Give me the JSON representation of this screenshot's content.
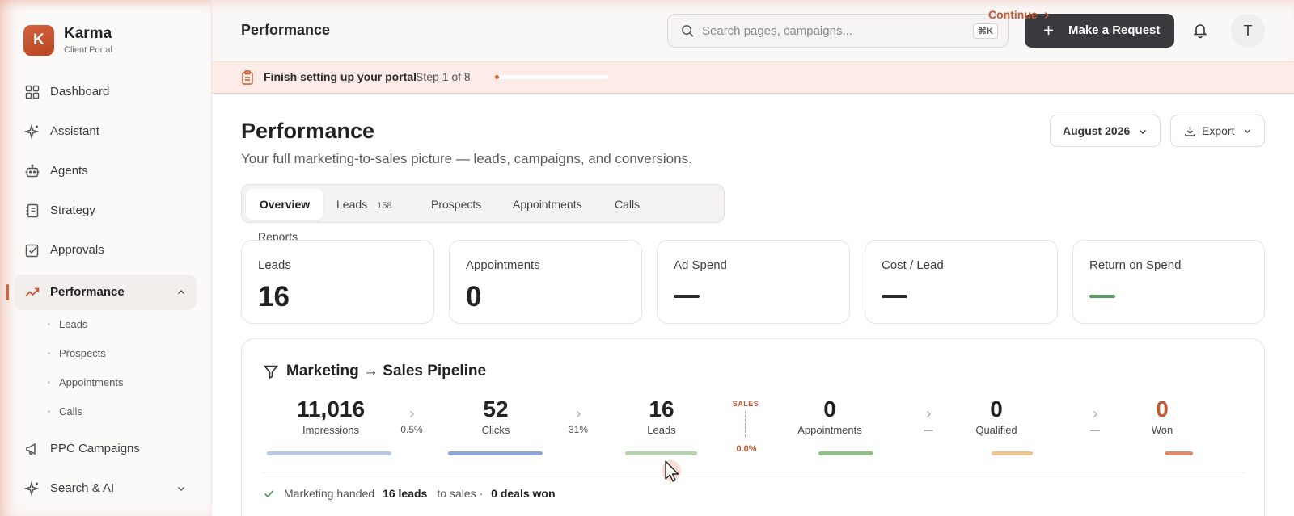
{
  "brand": {
    "logo_letter": "K",
    "name": "Karma",
    "subtitle": "Client Portal",
    "accent": "#d4623e"
  },
  "sidebar": {
    "items": [
      {
        "label": "Dashboard",
        "icon": "grid-icon"
      },
      {
        "label": "Assistant",
        "icon": "sparkle-icon"
      },
      {
        "label": "Agents",
        "icon": "robot-icon"
      },
      {
        "label": "Strategy",
        "icon": "notebook-icon"
      },
      {
        "label": "Approvals",
        "icon": "check-square-icon"
      },
      {
        "label": "Performance",
        "icon": "trend-icon",
        "active": true,
        "expanded": true
      },
      {
        "label": "PPC Campaigns",
        "icon": "megaphone-icon"
      },
      {
        "label": "Search & AI",
        "icon": "sparkle-icon"
      }
    ],
    "performance_sub": [
      "Leads",
      "Prospects",
      "Appointments",
      "Calls"
    ]
  },
  "topbar": {
    "title": "Performance",
    "search_placeholder": "Search pages, campaigns...",
    "search_shortcut": "⌘K",
    "request_label": "Make a Request",
    "avatar_letter": "T"
  },
  "banner": {
    "title": "Finish setting up your portal",
    "step": "Step 1 of 8",
    "progress": 0.125,
    "continue_label": "Continue"
  },
  "page": {
    "title": "Performance",
    "subtitle": "Your full marketing-to-sales picture — leads, campaigns, and conversions.",
    "month": "August 2026",
    "export_label": "Export"
  },
  "tabs": [
    {
      "label": "Overview",
      "active": true
    },
    {
      "label": "Leads",
      "count": "158"
    },
    {
      "label": "Prospects"
    },
    {
      "label": "Appointments"
    },
    {
      "label": "Calls"
    }
  ],
  "reports_label": "Reports",
  "metrics": [
    {
      "label": "Leads",
      "value": "16"
    },
    {
      "label": "Appointments",
      "value": "0"
    },
    {
      "label": "Ad Spend",
      "value": "—"
    },
    {
      "label": "Cost / Lead",
      "value": "—"
    },
    {
      "label": "Return on Spend",
      "value": "—",
      "color": "#5a9a63"
    }
  ],
  "pipeline": {
    "title": "Marketing → Sales Pipeline",
    "stages": [
      {
        "value": "11,016",
        "label": "Impressions",
        "color": "#b9c7e2"
      },
      {
        "value": "52",
        "label": "Clicks",
        "color": "#8ca4d8"
      },
      {
        "value": "16",
        "label": "Leads",
        "color": "#b7d0ad"
      },
      {
        "value": "0",
        "label": "Appointments",
        "color": "#93bd88"
      },
      {
        "value": "0",
        "label": "Qualified",
        "color": "#ecc48f"
      },
      {
        "value": "0",
        "label": "Won",
        "color": "#df8a6c",
        "value_color": "#c4572f"
      }
    ],
    "rates": [
      "0.5%",
      "31%",
      "—",
      "—"
    ],
    "sales_tag": "SALES",
    "sales_rate": "0.0%",
    "summary": {
      "prefix": "Marketing handed",
      "leads": "16 leads",
      "middle": "to sales ·",
      "deals": "0 deals won"
    }
  }
}
